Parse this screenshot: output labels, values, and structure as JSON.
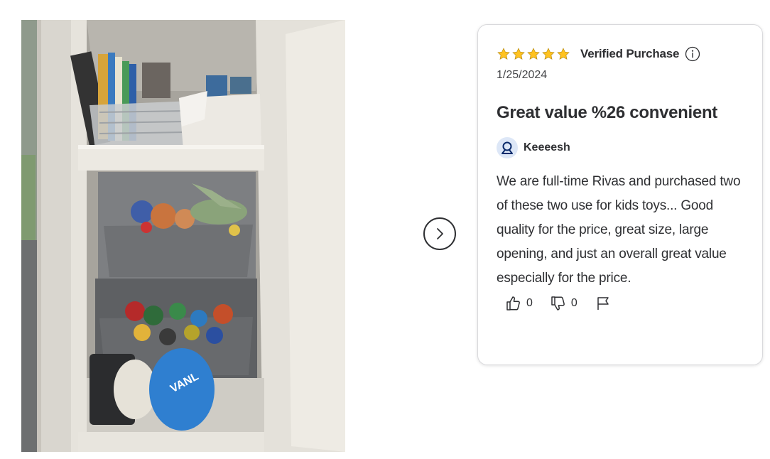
{
  "photo": {
    "alt_icon": "review-photo",
    "bag_text": "VANL"
  },
  "nav": {
    "next_icon": "chevron-right-icon"
  },
  "review": {
    "rating": 5,
    "rating_max": 5,
    "verified_label": "Verified Purchase",
    "date": "1/25/2024",
    "title": "Great value %26 convenient",
    "author": "Keeeesh",
    "body": "We are full-time Rivas and purchased two of these two use for kids toys... Good quality for the price, great size, large opening, and just an overall great value especially for the price.",
    "helpful_count": "0",
    "unhelpful_count": "0",
    "star_color": "#ffc220",
    "avatar_color": "#dde7f7",
    "avatar_icon_color": "#0a2a6b"
  }
}
